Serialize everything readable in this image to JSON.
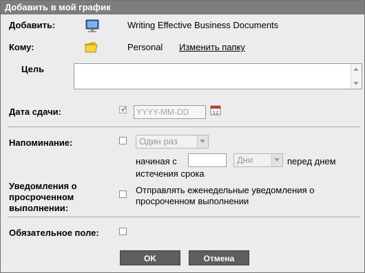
{
  "dialog": {
    "title": "Добавить в мой график"
  },
  "add": {
    "label": "Добавить:",
    "icon": "computer-monitor-icon",
    "value": "Writing Effective Business Documents"
  },
  "to": {
    "label": "Кому:",
    "icon": "folder-icon",
    "value": "Personal",
    "change_link": "Изменить папку"
  },
  "goal": {
    "label": "Цель",
    "value": ""
  },
  "due": {
    "label": "Дата сдачи:",
    "checked": true,
    "placeholder": "YYYY-MM-DD",
    "calendar_icon": "calendar-icon",
    "calendar_day": "12"
  },
  "reminder": {
    "label": "Напоминание:",
    "checked": false,
    "frequency_selected": "Один раз",
    "starting_label": "начиная с",
    "unit_selected": "Дни",
    "before_label": "перед днем",
    "expiry_label": "истечения срока"
  },
  "overdue": {
    "label_line1": "Уведомления о",
    "label_line2": "просроченном",
    "label_line3": "выполнении:",
    "checked": false,
    "text_line1": "Отправлять еженедельные уведомления о",
    "text_line2": "просроченном выполнении"
  },
  "required": {
    "label": "Обязательное поле:",
    "checked": false
  },
  "buttons": {
    "ok": "OK",
    "cancel": "Отмена"
  },
  "colors": {
    "titlebar": "#7d7d7d",
    "background": "#ececec",
    "button": "#5e5e5e"
  }
}
